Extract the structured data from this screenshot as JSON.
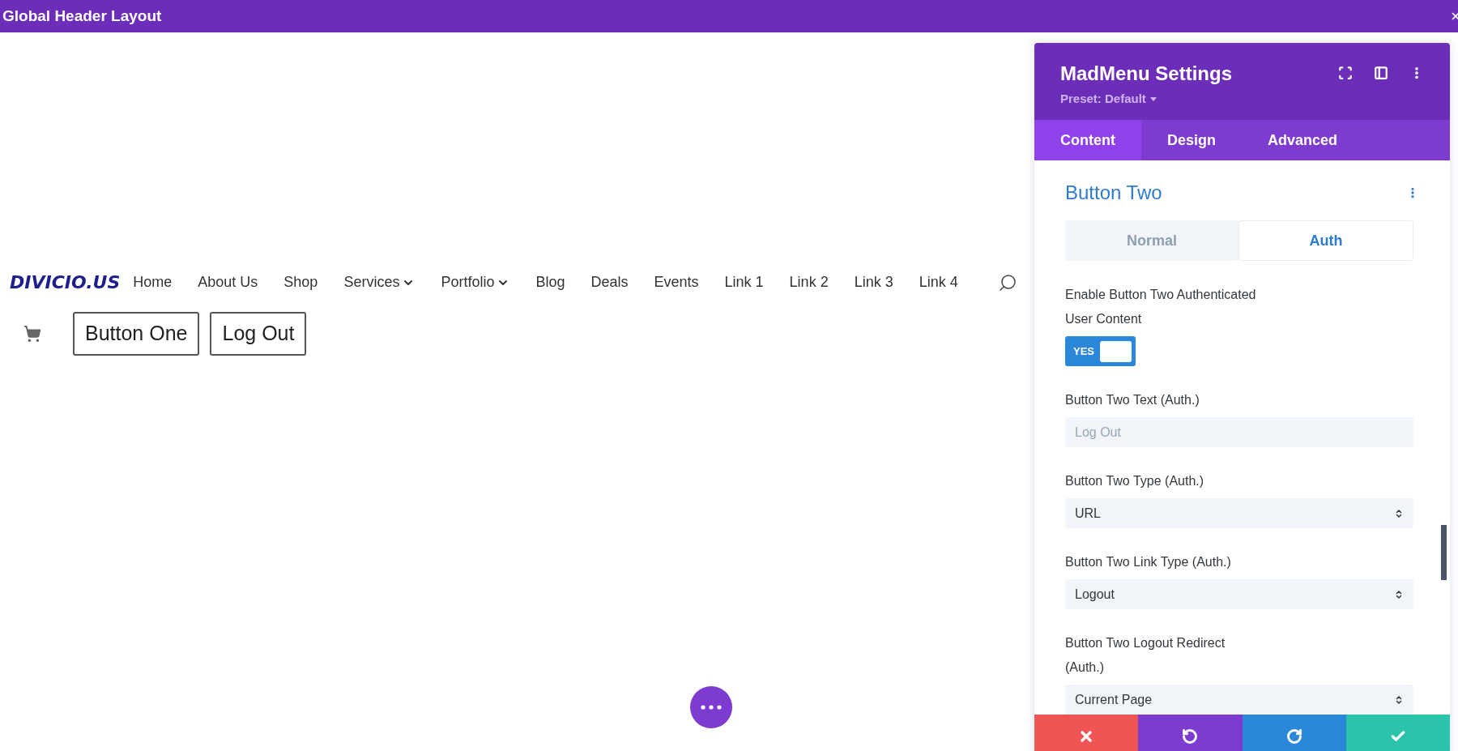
{
  "window": {
    "title": "Global Header Layout"
  },
  "canvas": {
    "logo": "DIVICIO.US",
    "menu": [
      {
        "label": "Home",
        "dropdown": false
      },
      {
        "label": "About Us",
        "dropdown": false
      },
      {
        "label": "Shop",
        "dropdown": false
      },
      {
        "label": "Services",
        "dropdown": true
      },
      {
        "label": "Portfolio",
        "dropdown": true
      },
      {
        "label": "Blog",
        "dropdown": false
      },
      {
        "label": "Deals",
        "dropdown": false
      },
      {
        "label": "Events",
        "dropdown": false
      },
      {
        "label": "Link 1",
        "dropdown": false
      },
      {
        "label": "Link 2",
        "dropdown": false
      },
      {
        "label": "Link 3",
        "dropdown": false
      },
      {
        "label": "Link 4",
        "dropdown": false
      }
    ],
    "buttons": [
      "Button One",
      "Log Out"
    ]
  },
  "panel": {
    "title": "MadMenu Settings",
    "preset": "Preset: Default",
    "tabs": [
      {
        "label": "Content",
        "selected": true
      },
      {
        "label": "Design",
        "selected": false
      },
      {
        "label": "Advanced",
        "selected": false
      }
    ],
    "section": "Button Two",
    "subtabs": [
      {
        "label": "Normal",
        "selected": false
      },
      {
        "label": "Auth",
        "selected": true
      }
    ],
    "fields": [
      {
        "kind": "toggle",
        "label": "Enable Button Two Authenticated User Content",
        "on": true,
        "text": "YES"
      },
      {
        "kind": "text",
        "label": "Button Two Text (Auth.)",
        "placeholder": "Log Out"
      },
      {
        "kind": "select",
        "label": "Button Two Type (Auth.)",
        "value": "URL"
      },
      {
        "kind": "select",
        "label": "Button Two Link Type (Auth.)",
        "value": "Logout"
      },
      {
        "kind": "select",
        "label": "Button Two Logout Redirect (Auth.)",
        "value": "Current Page"
      }
    ]
  }
}
